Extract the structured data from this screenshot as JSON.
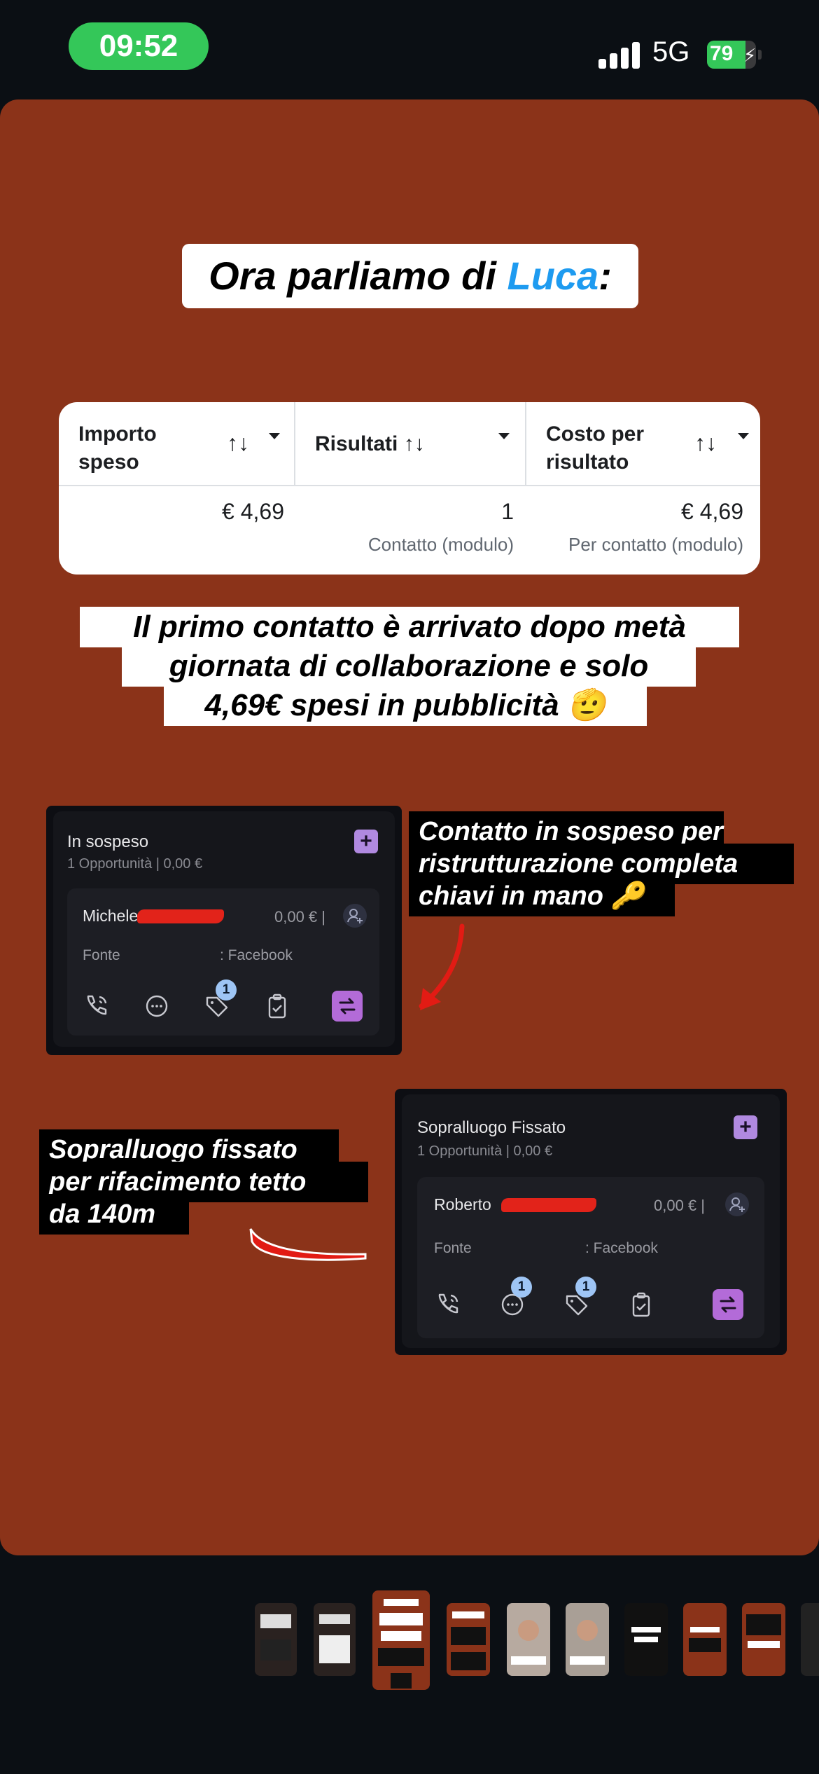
{
  "status": {
    "time": "09:52",
    "network": "5G",
    "battery": "79",
    "battery_level": 0.79
  },
  "colors": {
    "story_bg": "#8b3319",
    "accent_blue": "#1e9bf0",
    "time_pill": "#34c759"
  },
  "story": {
    "title_prefix": "Ora parliamo di ",
    "title_highlight": "Luca",
    "title_suffix": ":",
    "table": {
      "columns": [
        {
          "label_line1": "Importo",
          "label_line2": "speso",
          "sort_icon": "↑↓"
        },
        {
          "label_line1": "Risultati",
          "label_line2": "",
          "sort_icon": "↑↓"
        },
        {
          "label_line1": "Costo per",
          "label_line2": "risultato",
          "sort_icon": "↑↓"
        }
      ],
      "row": [
        {
          "value": "€ 4,69",
          "sub": ""
        },
        {
          "value": "1",
          "sub": "Contatto (modulo)"
        },
        {
          "value": "€ 4,69",
          "sub": "Per contatto (modulo)"
        }
      ]
    },
    "caption_lines": [
      "Il primo contatto è arrivato dopo metà",
      "giornata di collaborazione e solo",
      "4,69€ spesi in pubblicità 🫡"
    ],
    "card1": {
      "stage": "In sospeso",
      "summary": "1 Opportunità | 0,00 €",
      "lead_name": "Michele",
      "amount": "0,00 € |",
      "fonte_label": "Fonte",
      "fonte_value": ": Facebook",
      "badges": {
        "tag": "1"
      }
    },
    "note1_lines": [
      "Contatto in sospeso per",
      "ristrutturazione completa",
      "chiavi in mano 🔑"
    ],
    "card2": {
      "stage": "Sopralluogo Fissato",
      "summary": "1 Opportunità | 0,00 €",
      "lead_name": "Roberto",
      "amount": "0,00 € |",
      "fonte_label": "Fonte",
      "fonte_value": ": Facebook",
      "badges": {
        "chat": "1",
        "tag": "1"
      }
    },
    "note2_lines": [
      "Sopralluogo fissato",
      "per rifacimento tetto",
      "da 140m"
    ]
  },
  "thumbnails": [
    "story-1",
    "story-2",
    "story-3",
    "story-4",
    "story-5",
    "story-6",
    "story-7",
    "story-8",
    "story-9",
    "story-10"
  ]
}
